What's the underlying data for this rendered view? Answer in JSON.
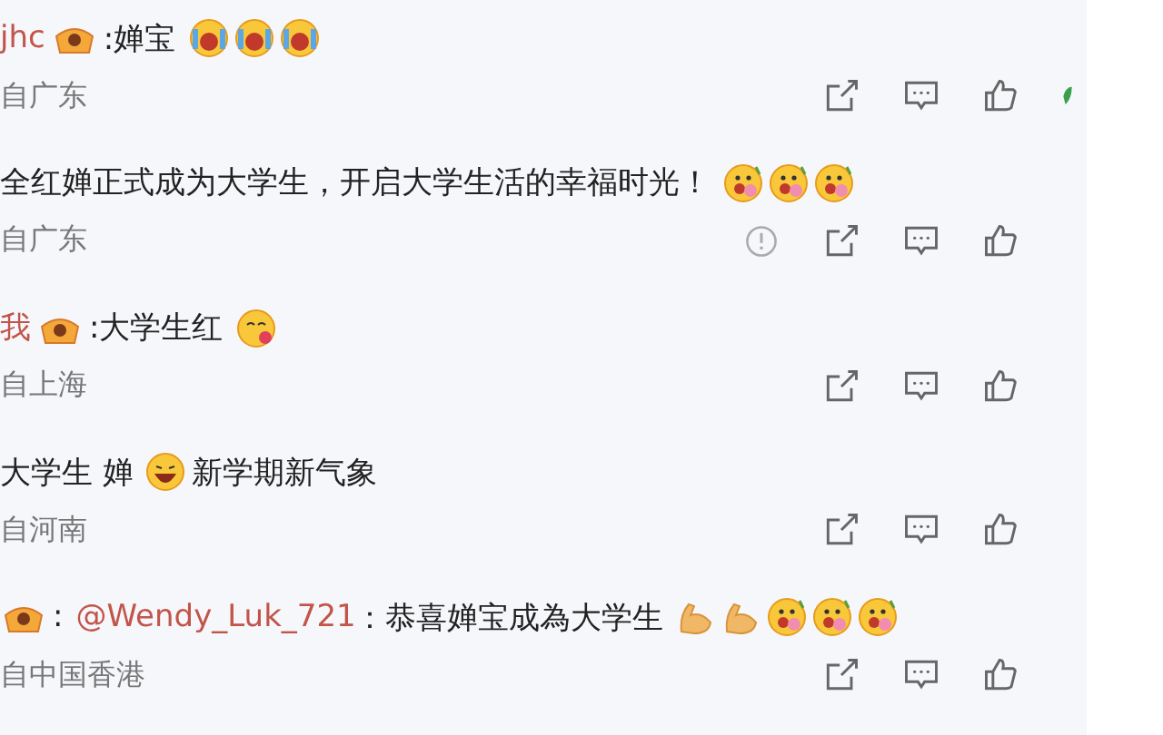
{
  "comments": [
    {
      "parts": [
        {
          "kind": "user",
          "text": "jhc"
        },
        {
          "kind": "badge"
        },
        {
          "kind": "text",
          "text": ":婵宝"
        },
        {
          "kind": "cry"
        },
        {
          "kind": "cry"
        },
        {
          "kind": "cry"
        }
      ],
      "location": "自广东",
      "actions": [
        {
          "kind": "share"
        },
        {
          "kind": "comment"
        },
        {
          "kind": "like"
        },
        {
          "kind": "leaf"
        }
      ]
    },
    {
      "parts": [
        {
          "kind": "text",
          "text": "全红婵正式成为大学生，开启大学生活的幸福时光！"
        },
        {
          "kind": "flower"
        },
        {
          "kind": "flower"
        },
        {
          "kind": "flower"
        }
      ],
      "location": "自广东",
      "actions": [
        {
          "kind": "report"
        },
        {
          "kind": "share"
        },
        {
          "kind": "comment"
        },
        {
          "kind": "like"
        }
      ]
    },
    {
      "parts": [
        {
          "kind": "user",
          "text": "我"
        },
        {
          "kind": "badge"
        },
        {
          "kind": "text",
          "text": ":大学生红"
        },
        {
          "kind": "blush"
        }
      ],
      "location": "自上海",
      "actions": [
        {
          "kind": "share"
        },
        {
          "kind": "comment"
        },
        {
          "kind": "like"
        }
      ]
    },
    {
      "parts": [
        {
          "kind": "text",
          "text": "大学生 婵"
        },
        {
          "kind": "laugh"
        },
        {
          "kind": "text",
          "text": "新学期新气象"
        }
      ],
      "location": "自河南",
      "actions": [
        {
          "kind": "share"
        },
        {
          "kind": "comment"
        },
        {
          "kind": "like"
        }
      ]
    },
    {
      "parts": [
        {
          "kind": "badge"
        },
        {
          "kind": "text",
          "text": ":"
        },
        {
          "kind": "mention",
          "text": "@Wendy_Luk_721"
        },
        {
          "kind": "text",
          "text": "：恭喜婵宝成為大学生"
        },
        {
          "kind": "muscle"
        },
        {
          "kind": "muscle"
        },
        {
          "kind": "flower"
        },
        {
          "kind": "flower"
        },
        {
          "kind": "flower"
        }
      ],
      "location": "自中国香港",
      "actions": [
        {
          "kind": "share"
        },
        {
          "kind": "comment"
        },
        {
          "kind": "like"
        }
      ]
    }
  ]
}
